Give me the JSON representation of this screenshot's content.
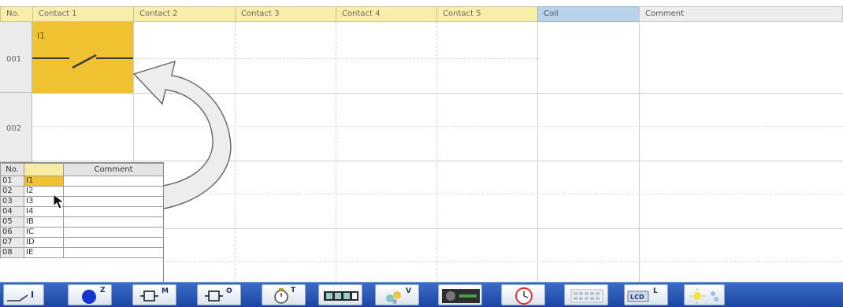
{
  "columns": {
    "no": "No.",
    "contact1": "Contact 1",
    "contact2": "Contact 2",
    "contact3": "Contact 3",
    "contact4": "Contact 4",
    "contact5": "Contact 5",
    "coil": "Coil",
    "comment": "Comment"
  },
  "rows": [
    {
      "no": "001",
      "contact1": "I1"
    },
    {
      "no": "002"
    }
  ],
  "input_list": {
    "header_no": "No.",
    "header_name": "",
    "header_comment": "Comment",
    "items": [
      {
        "no": "01",
        "name": "I1"
      },
      {
        "no": "02",
        "name": "I2"
      },
      {
        "no": "03",
        "name": "I3"
      },
      {
        "no": "04",
        "name": "I4"
      },
      {
        "no": "05",
        "name": "IB"
      },
      {
        "no": "06",
        "name": "IC"
      },
      {
        "no": "07",
        "name": "ID"
      },
      {
        "no": "08",
        "name": "IE"
      }
    ]
  },
  "toolbar": {
    "buttons": [
      {
        "icon": "contact-input-icon",
        "label": "I"
      },
      {
        "icon": "blue-circle-icon",
        "label": "Z"
      },
      {
        "icon": "relay-m-icon",
        "label": "M"
      },
      {
        "icon": "relay-o-icon",
        "label": "O"
      },
      {
        "icon": "timer-icon",
        "label": "T"
      },
      {
        "icon": "counter-icon",
        "label": ""
      },
      {
        "icon": "compare-v-icon",
        "label": "V"
      },
      {
        "icon": "analog-icon",
        "label": ""
      },
      {
        "icon": "clock-icon",
        "label": ""
      },
      {
        "icon": "keypad-icon",
        "label": ""
      },
      {
        "icon": "lcd-icon",
        "label": "L"
      },
      {
        "icon": "light-icon",
        "label": ""
      }
    ]
  },
  "colors": {
    "header_yellow": "#f8eeaa",
    "coil_blue": "#b8d2ea",
    "selected_cell": "#f0c232",
    "toolbar_blue": "#2a56b4"
  }
}
